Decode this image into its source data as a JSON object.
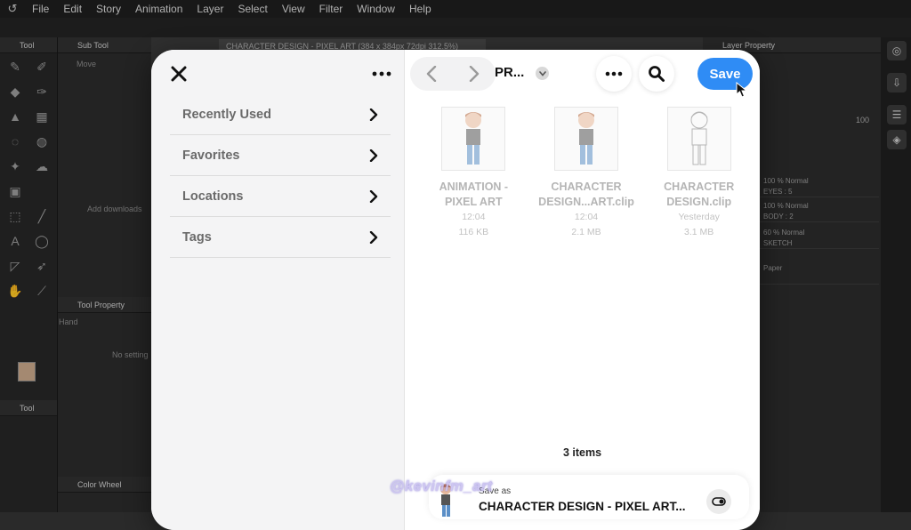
{
  "background_app": {
    "menu": [
      "File",
      "Edit",
      "Story",
      "Animation",
      "Layer",
      "Select",
      "View",
      "Filter",
      "Window",
      "Help"
    ],
    "panels": {
      "tool": "Tool",
      "sub_tool": "Sub Tool",
      "move": "Move",
      "add_download": "Add downloads",
      "tool_property": "Tool Property",
      "hand": "Hand",
      "no_setting": "No setting",
      "tool2": "Tool",
      "color_wheel": "Color Wheel",
      "layer_property": "Layer Property",
      "canvas_tab": "CHARACTER DESIGN - PIXEL ART (384 x 384px 72dpi 312.5%)",
      "opacity_value": "100"
    },
    "layers": [
      {
        "line1": "100 %  Normal",
        "line2": "EYES : 5"
      },
      {
        "line1": "100 %  Normal",
        "line2": "BODY : 2"
      },
      {
        "line1": "60 %  Normal",
        "line2": "SKETCH"
      },
      {
        "line1": "",
        "line2": "Paper"
      }
    ]
  },
  "dialog": {
    "sidebar": {
      "items": [
        {
          "label": "Recently Used"
        },
        {
          "label": "Favorites"
        },
        {
          "label": "Locations"
        },
        {
          "label": "Tags"
        }
      ]
    },
    "header": {
      "folder_title": "PR...",
      "save_label": "Save"
    },
    "files": [
      {
        "name_line1": "ANIMATION -",
        "name_line2": "PIXEL ART",
        "time": "12:04",
        "size": "116 KB"
      },
      {
        "name_line1": "CHARACTER",
        "name_line2": "DESIGN...ART.clip",
        "time": "12:04",
        "size": "2.1 MB"
      },
      {
        "name_line1": "CHARACTER",
        "name_line2": "DESIGN.clip",
        "time": "Yesterday",
        "size": "3.1 MB"
      }
    ],
    "items_count": "3 items",
    "save_as": {
      "label": "Save as",
      "filename": "CHARACTER DESIGN - PIXEL ART..."
    }
  },
  "watermark": "@kevinfm_art",
  "colors": {
    "accent": "#2f8cf5",
    "sidebar_bg": "#f4f4f5",
    "app_bg": "#2a2a2a"
  }
}
